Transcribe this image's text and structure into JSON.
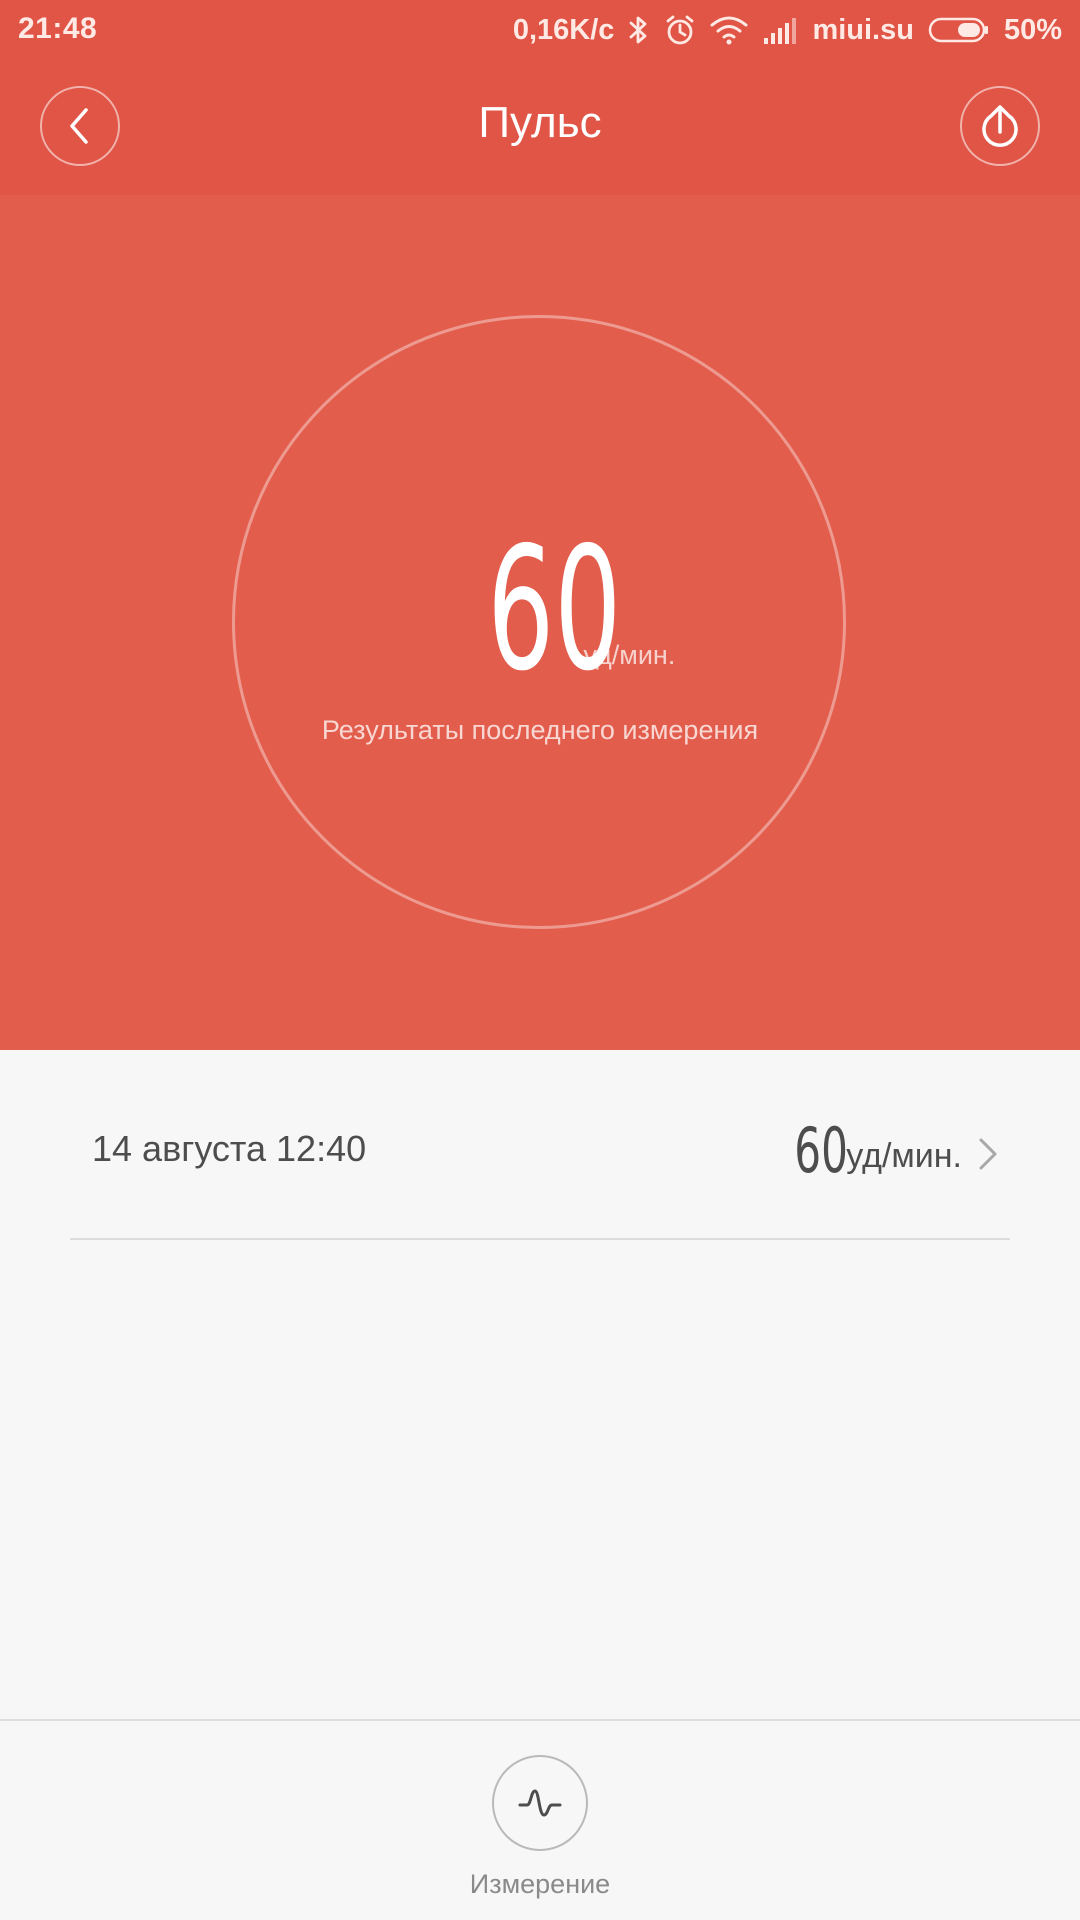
{
  "status_bar": {
    "time": "21:48",
    "network_speed": "0,16K/c",
    "carrier": "miui.su",
    "battery": "50%",
    "icons": [
      "bluetooth-icon",
      "alarm-icon",
      "wifi-icon",
      "signal-icon",
      "battery-icon"
    ]
  },
  "app_bar": {
    "title": "Пульс",
    "back_icon": "chevron-left-icon",
    "share_icon": "upload-icon"
  },
  "hero": {
    "value": "60",
    "unit": "уд/мин.",
    "caption": "Результаты последнего измерения"
  },
  "history": [
    {
      "date": "14 августа 12:40",
      "value": "60",
      "unit": "уд/мин."
    }
  ],
  "bottom_bar": {
    "measure_label": "Измерение",
    "measure_icon": "pulse-wave-icon"
  },
  "colors": {
    "header": "#e05546",
    "hero": "#e35d4d",
    "background": "#f7f7f7",
    "text_dark": "#4d4d4d",
    "text_muted": "#8a8a8a"
  }
}
